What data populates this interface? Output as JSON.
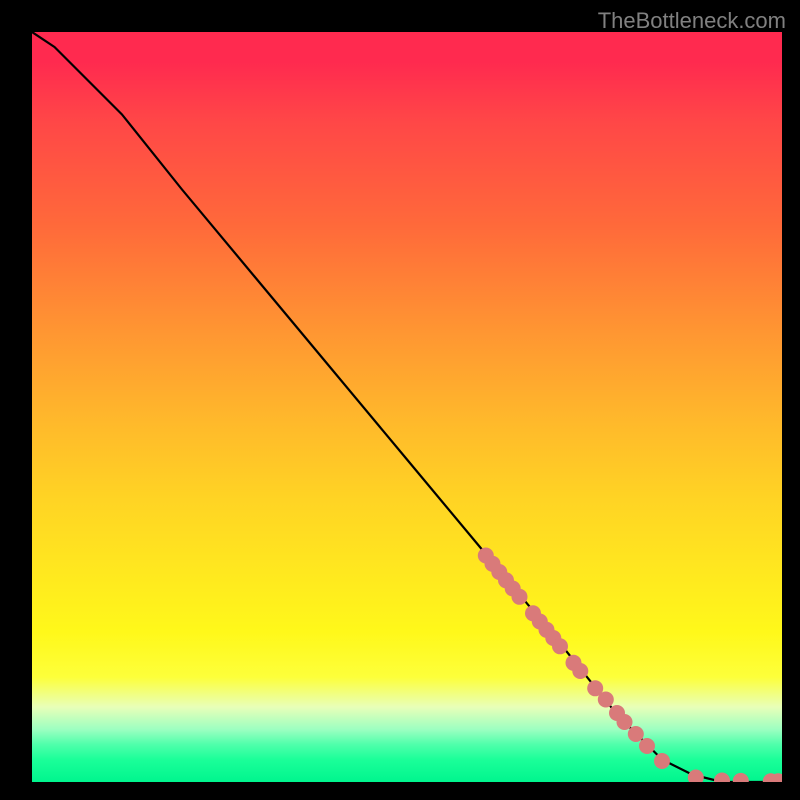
{
  "attribution": "TheBottleneck.com",
  "chart_data": {
    "type": "line",
    "title": "",
    "xlabel": "",
    "ylabel": "",
    "xlim": [
      0,
      100
    ],
    "ylim": [
      0,
      100
    ],
    "grid": false,
    "legend": null,
    "series": [
      {
        "name": "curve",
        "type": "line",
        "x": [
          0,
          3,
          7,
          12,
          20,
          30,
          40,
          50,
          60,
          70,
          78,
          84,
          88,
          92,
          95,
          98,
          100
        ],
        "y": [
          100,
          98,
          94,
          89,
          79,
          67,
          55,
          43,
          31,
          19,
          9,
          3,
          1,
          0,
          0,
          0,
          0
        ]
      },
      {
        "name": "markers",
        "type": "scatter",
        "x": [
          60.5,
          61.4,
          62.3,
          63.2,
          64.1,
          65.0,
          66.8,
          67.7,
          68.6,
          69.5,
          70.4,
          72.2,
          73.1,
          75.1,
          76.5,
          78.0,
          79.0,
          80.5,
          82.0,
          84.0,
          88.5,
          92.0,
          94.5,
          98.5,
          99.5
        ],
        "y": [
          30.2,
          29.1,
          28.0,
          26.9,
          25.8,
          24.7,
          22.5,
          21.4,
          20.3,
          19.2,
          18.1,
          15.9,
          14.8,
          12.5,
          11.0,
          9.2,
          8.0,
          6.4,
          4.8,
          2.8,
          0.6,
          0.2,
          0.15,
          0.1,
          0.1
        ]
      }
    ],
    "background_gradient": {
      "top": "#ff2a4f",
      "middle": "#ffe81f",
      "bottom": "#00f58e"
    }
  }
}
